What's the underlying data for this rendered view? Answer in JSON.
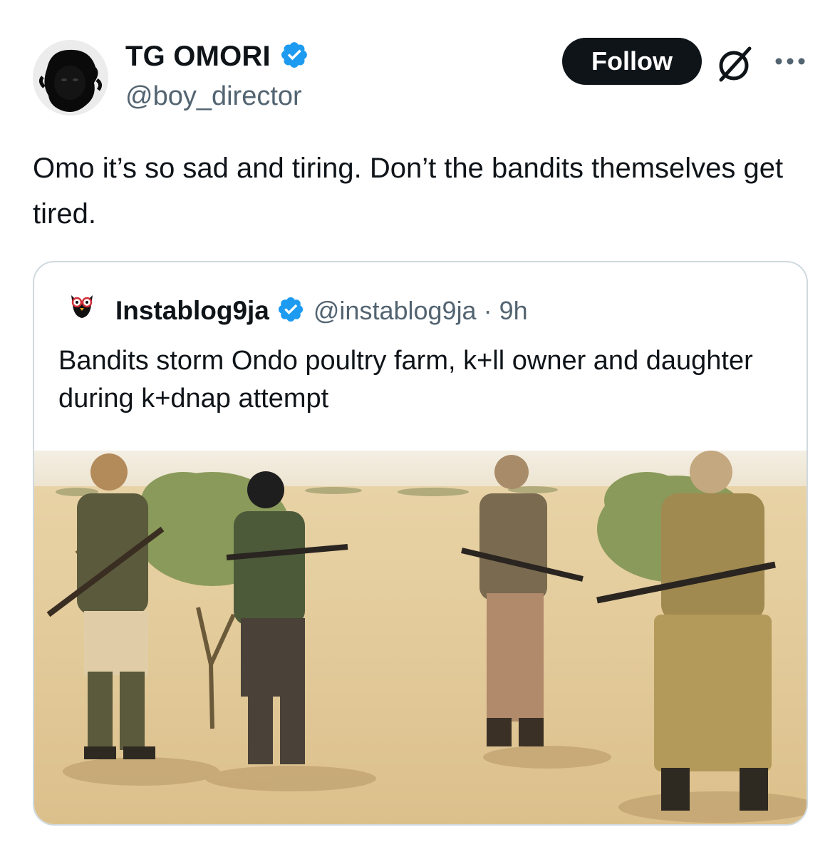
{
  "tweet": {
    "author": {
      "display_name": "TG OMORI",
      "handle": "@boy_director",
      "verified": true
    },
    "follow_label": "Follow",
    "text": "Omo it’s so sad and tiring. Don’t the bandits themselves get tired."
  },
  "quote": {
    "author": {
      "display_name": "Instablog9ja",
      "handle": "@instablog9ja",
      "avatar_text": "instablog9ja",
      "verified": true
    },
    "separator": "·",
    "time": "9h",
    "text": "Bandits storm Ondo poultry farm, k+ll owner and daughter during k+dnap attempt",
    "media_icon": "photo-desert-armed-men"
  },
  "icons": {
    "verified": "verified-badge-icon",
    "grok": "grok-icon",
    "more": "more-dots-icon"
  },
  "colors": {
    "verified_blue": "#1d9bf0",
    "follow_bg": "#0f1419",
    "text": "#0f1419",
    "secondary": "#536471",
    "border": "#cfd9de"
  }
}
